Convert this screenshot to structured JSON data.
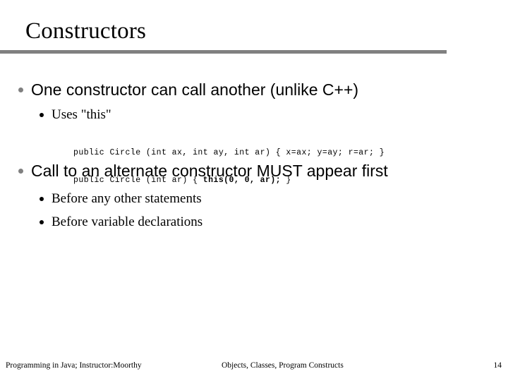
{
  "slide": {
    "title": "Constructors",
    "rule_color": "#808080",
    "background": "#ffffff",
    "text_color": "#000000"
  },
  "bullets": {
    "level1_marker_color": "#808080",
    "level2_marker_color": "#000000",
    "items": [
      {
        "level": 1,
        "text": "One constructor can call another (unlike C++)"
      },
      {
        "level": 2,
        "text": "Uses \"this\""
      },
      {
        "level": 1,
        "text": "Call to an alternate constructor MUST appear first"
      },
      {
        "level": 2,
        "text": "Before any other statements"
      },
      {
        "level": 2,
        "text": "Before variable declarations"
      }
    ]
  },
  "code": {
    "line1_plain": "public Circle (int ax, int ay, int ar) { x=ax; y=ay; r=ar; }",
    "line2_pre": "public Circle (int ar) { ",
    "line2_bold": "this(0, 0, ar);",
    "line2_post": " }"
  },
  "footer": {
    "left": "Programming in Java; Instructor:Moorthy",
    "center": "Objects, Classes, Program Constructs",
    "page_number": "14"
  }
}
